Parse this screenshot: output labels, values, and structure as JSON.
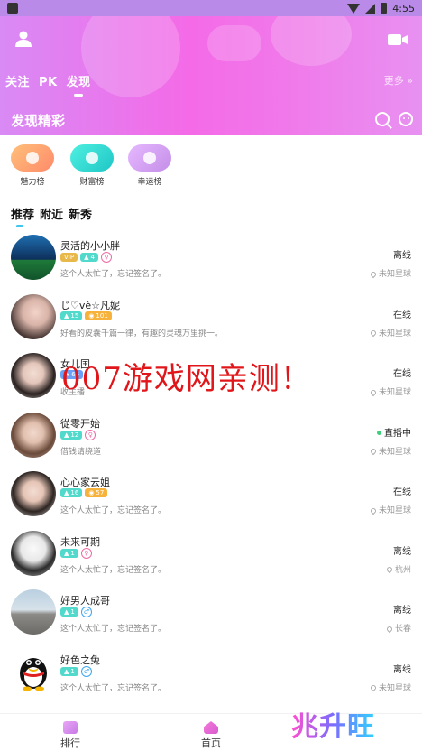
{
  "status_bar": {
    "time": "4:55"
  },
  "header": {
    "tabs": [
      {
        "label": "关注"
      },
      {
        "label": "PK"
      },
      {
        "label": "发现"
      }
    ],
    "more_label": "更多 »",
    "section_title": "发现精彩"
  },
  "ranks": [
    {
      "label": "魅力榜",
      "color": "#ffb06a",
      "icon": "charm-rank-icon"
    },
    {
      "label": "财富榜",
      "color": "#3fe0d0",
      "icon": "wealth-rank-icon"
    },
    {
      "label": "幸运榜",
      "color": "#d9a8f5",
      "icon": "lucky-rank-icon"
    }
  ],
  "subtabs": [
    {
      "label": "推荐"
    },
    {
      "label": "附近"
    },
    {
      "label": "新秀"
    }
  ],
  "users": [
    {
      "name": "灵活的小小胖",
      "level": "4",
      "extra": "VIP",
      "gender": "♀",
      "signature": "这个人太忙了，忘记签名了。",
      "status": "离线",
      "location": "未知星球"
    },
    {
      "name": "じ♡vè☆凡妮",
      "level": "15",
      "extra": "101",
      "gender": "",
      "signature": "好看的皮囊千篇一律，有趣的灵魂万里挑一。",
      "status": "在线",
      "location": "未知星球"
    },
    {
      "name": "女儿国",
      "level": "65",
      "extra": "",
      "gender": "",
      "signature": "收主播",
      "status": "在线",
      "location": "未知星球"
    },
    {
      "name": "從零开始",
      "level": "12",
      "extra": "",
      "gender": "♀",
      "signature": "借钱请绕道",
      "status": "直播中",
      "location": "未知星球"
    },
    {
      "name": "心心家云姐",
      "level": "16",
      "extra": "57",
      "gender": "",
      "signature": "这个人太忙了，忘记签名了。",
      "status": "在线",
      "location": "未知星球"
    },
    {
      "name": "未来可期",
      "level": "1",
      "extra": "",
      "gender": "♀",
      "signature": "这个人太忙了，忘记签名了。",
      "status": "离线",
      "location": "杭州"
    },
    {
      "name": "好男人成哥",
      "level": "1",
      "extra": "",
      "gender": "♂",
      "signature": "这个人太忙了，忘记签名了。",
      "status": "离线",
      "location": "长春"
    },
    {
      "name": "好色之兔",
      "level": "1",
      "extra": "",
      "gender": "♂",
      "signature": "这个人太忙了，忘记签名了。",
      "status": "离线",
      "location": "未知星球"
    }
  ],
  "watermark": "007游戏网亲测！",
  "bottom_nav": [
    {
      "label": "排行"
    },
    {
      "label": "首页"
    }
  ],
  "brand": "兆升旺"
}
